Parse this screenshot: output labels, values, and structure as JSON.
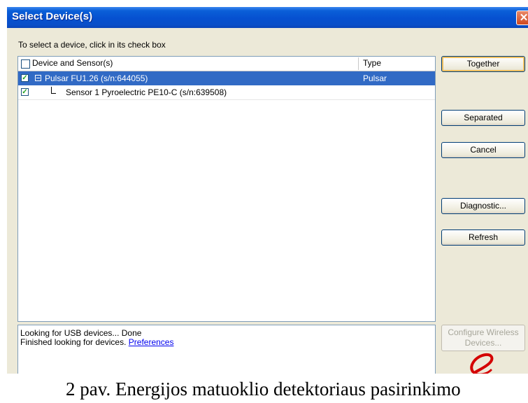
{
  "window": {
    "title": "Select Device(s)",
    "close_glyph": "✕"
  },
  "instruction": "To select a device, click in its check box",
  "list": {
    "header": {
      "device": "Device and Sensor(s)",
      "type": "Type"
    },
    "rows": [
      {
        "label": "Pulsar FU1.26 (s/n:644055)",
        "type": "Pulsar",
        "checked": true,
        "selected": true
      },
      {
        "label": "Sensor 1 Pyroelectric PE10-C (s/n:639508)",
        "type": "",
        "checked": true,
        "selected": false
      }
    ]
  },
  "buttons": {
    "together": "Together",
    "separated": "Separated",
    "cancel": "Cancel",
    "diagnostic": "Diagnostic...",
    "refresh": "Refresh",
    "configure_line1": "Configure Wireless",
    "configure_line2": "Devices..."
  },
  "status": {
    "line1": "Looking for USB devices... Done",
    "line2_prefix": "Finished looking for devices.",
    "link": "Preferences"
  },
  "caption": "2 pav. Energijos matuoklio detektoriaus pasirinkimo",
  "colors": {
    "title_bar": "#0650d0",
    "selection": "#316ac5",
    "link": "#0000ee",
    "logo": "#d40000"
  }
}
